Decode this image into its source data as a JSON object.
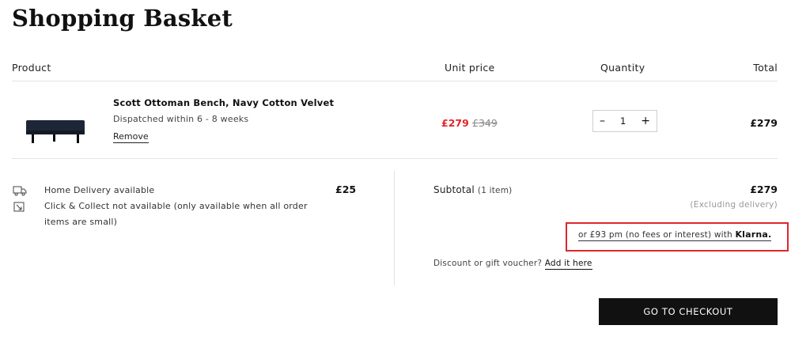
{
  "page": {
    "title": "Shopping Basket"
  },
  "table": {
    "headers": {
      "product": "Product",
      "unit_price": "Unit price",
      "quantity": "Quantity",
      "total": "Total"
    }
  },
  "item": {
    "name": "Scott Ottoman Bench, Navy Cotton Velvet",
    "dispatch": "Dispatched within 6 - 8 weeks",
    "remove_label": "Remove",
    "sale_price": "£279",
    "was_price": "£349",
    "quantity": "1",
    "decrement": "–",
    "increment": "+",
    "total": "£279",
    "image_icon": "navy-velvet-ottoman-bench"
  },
  "delivery": {
    "home": "Home Delivery available",
    "home_price": "£25",
    "collect": "Click & Collect not available (only available when all order items are small)",
    "home_icon": "truck-icon",
    "collect_icon": "store-pickup-icon"
  },
  "summary": {
    "subtotal_label": "Subtotal",
    "subtotal_count": "(1 item)",
    "subtotal_value": "£279",
    "excluding": "(Excluding delivery)",
    "klarna_text": "or £93 pm (no fees or interest) with",
    "klarna_brand": "Klarna.",
    "discount_prompt": "Discount or gift voucher?",
    "discount_link": "Add it here",
    "checkout_label": "GO TO CHECKOUT"
  },
  "colors": {
    "sale": "#e0262b",
    "highlight": "#e0262b",
    "button": "#111111"
  }
}
